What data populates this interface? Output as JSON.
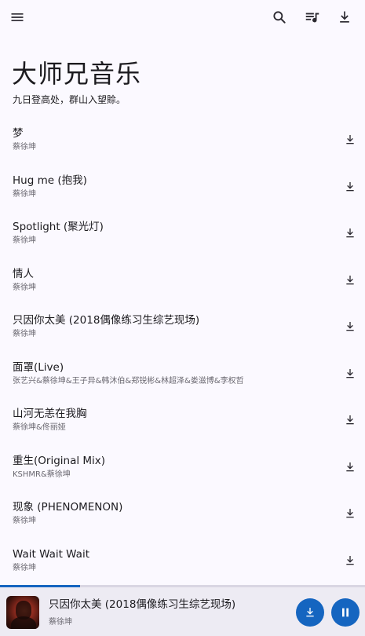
{
  "app_bar": {
    "icons": [
      "menu-icon",
      "search-icon",
      "queue-music-icon",
      "download-icon"
    ]
  },
  "header": {
    "title": "大师兄音乐",
    "subtitle": "九日登高处，群山入望賒。"
  },
  "songs": [
    {
      "title": "梦",
      "artist": "蔡徐坤"
    },
    {
      "title": "Hug me (抱我)",
      "artist": "蔡徐坤"
    },
    {
      "title": "Spotlight (聚光灯)",
      "artist": "蔡徐坤"
    },
    {
      "title": "情人",
      "artist": "蔡徐坤"
    },
    {
      "title": "只因你太美 (2018偶像练习生综艺现场)",
      "artist": "蔡徐坤"
    },
    {
      "title": "面罩(Live)",
      "artist": "张艺兴&蔡徐坤&王子异&韩沐伯&郑锐彬&林超泽&娄滋博&李权哲"
    },
    {
      "title": "山河无恙在我胸",
      "artist": "蔡徐坤&佟丽娅"
    },
    {
      "title": "重生(Original Mix)",
      "artist": "KSHMR&蔡徐坤"
    },
    {
      "title": "现象 (PHENOMENON)",
      "artist": "蔡徐坤"
    },
    {
      "title": "Wait Wait Wait",
      "artist": "蔡徐坤"
    }
  ],
  "player": {
    "title": "只因你太美 (2018偶像练习生综艺现场)",
    "artist": "蔡徐坤",
    "progress": 0.22,
    "state": "playing"
  },
  "colors": {
    "background": "#fbf9ff",
    "accent": "#1565c0",
    "text": "#1c1b1f",
    "secondary_text": "#6a6870",
    "player_bg": "#edebf3"
  }
}
